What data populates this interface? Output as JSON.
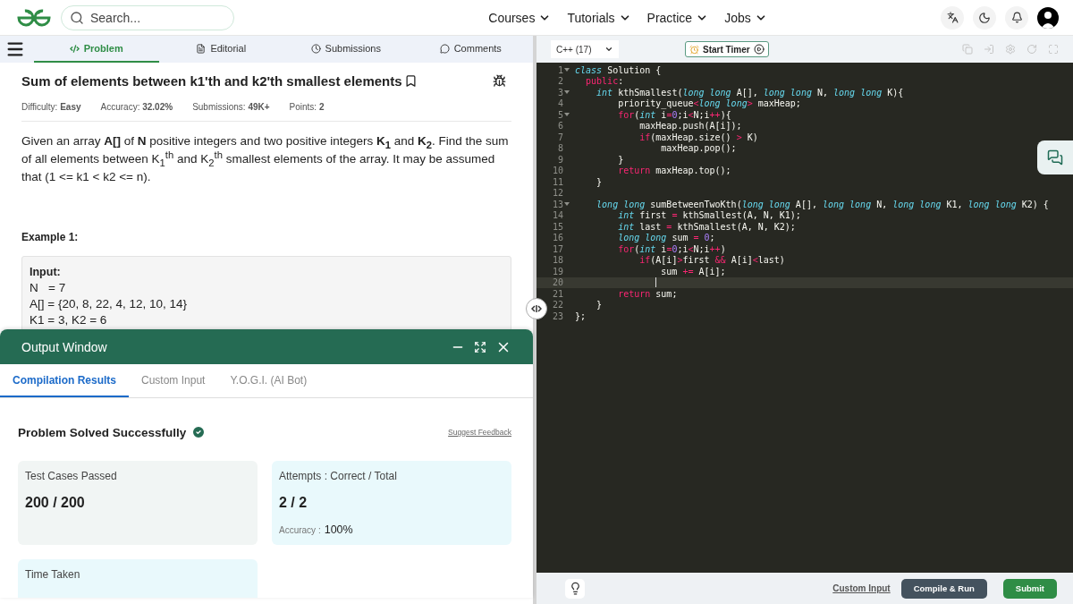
{
  "header": {
    "search": {
      "placeholder": "Search..."
    },
    "nav": [
      {
        "label": "Courses"
      },
      {
        "label": "Tutorials"
      },
      {
        "label": "Practice"
      },
      {
        "label": "Jobs"
      }
    ]
  },
  "problem_tabs": [
    {
      "label": "Problem",
      "selected": true
    },
    {
      "label": "Editorial",
      "selected": false
    },
    {
      "label": "Submissions",
      "selected": false
    },
    {
      "label": "Comments",
      "selected": false
    }
  ],
  "problem": {
    "title": "Sum of elements between k1'th and k2'th smallest elements",
    "meta": [
      "Difficulty: **Easy**",
      "Accuracy: **32.02%**",
      "Submissions: **49K+**",
      "Points: **2**"
    ],
    "description": "Given an array **A[]** of **N** positive integers and two positive integers **K$_{1}$** and **K$_{2}$**. Find the sum of all elements between K$_{1}$$^{th}$ and K$_{2}$$^{th}$ smallest elements of the array. It may be assumed that (1 <= k1 < k2 <= n).",
    "example": {
      "heading": "Example 1:",
      "label": "Input:",
      "lines": [
        "N   = 7",
        "A[] = {20, 8, 22, 4, 12, 10, 14}",
        "K1 = 3, K2 = 6"
      ]
    }
  },
  "output_window": {
    "title": "Output Window",
    "tabs": [
      {
        "label": "Compilation Results",
        "selected": true
      },
      {
        "label": "Custom Input",
        "selected": false
      },
      {
        "label": "Y.O.G.I. (AI Bot)",
        "selected": false
      }
    ],
    "status": "Problem Solved Successfully",
    "feedback_link": "Suggest Feedback",
    "cards": [
      {
        "title": "Test Cases Passed",
        "value": "200 / 200",
        "color": "#f1f5f4"
      },
      {
        "title": "Attempts : Correct / Total",
        "value": "2 / 2",
        "note_label": "Accuracy :",
        "note_value": "100%",
        "color": "#e9f9fc"
      },
      {
        "title": "Time Taken",
        "color": "#e9f9fc"
      }
    ]
  },
  "editor": {
    "language": "C++ (17)",
    "timer_button": "Start Timer",
    "lines": [
      {
        "number": "1",
        "fold": true,
        "current": false,
        "tokens": [
          {
            "kind": "storage",
            "text": "class"
          },
          {
            "kind": "plain",
            "text": " Solution {"
          }
        ]
      },
      {
        "number": "2",
        "fold": false,
        "current": false,
        "tokens": [
          {
            "kind": "keyword",
            "text": "  public"
          },
          {
            "kind": "plain",
            "text": ":"
          }
        ]
      },
      {
        "number": "3",
        "fold": true,
        "current": false,
        "tokens": [
          {
            "kind": "storage",
            "text": "    int"
          },
          {
            "kind": "plain",
            "text": " kthSmallest("
          },
          {
            "kind": "storage",
            "text": "long long"
          },
          {
            "kind": "plain",
            "text": " A[], "
          },
          {
            "kind": "storage",
            "text": "long long"
          },
          {
            "kind": "plain",
            "text": " N, "
          },
          {
            "kind": "storage",
            "text": "long long"
          },
          {
            "kind": "plain",
            "text": " K){"
          }
        ]
      },
      {
        "number": "4",
        "fold": false,
        "current": false,
        "tokens": [
          {
            "kind": "plain",
            "text": "        priority_queue"
          },
          {
            "kind": "operator",
            "text": "<"
          },
          {
            "kind": "storage",
            "text": "long long"
          },
          {
            "kind": "operator",
            "text": ">"
          },
          {
            "kind": "plain",
            "text": " maxHeap;"
          }
        ]
      },
      {
        "number": "5",
        "fold": true,
        "current": false,
        "tokens": [
          {
            "kind": "keyword",
            "text": "        for"
          },
          {
            "kind": "plain",
            "text": "("
          },
          {
            "kind": "storage",
            "text": "int"
          },
          {
            "kind": "plain",
            "text": " i"
          },
          {
            "kind": "operator",
            "text": "="
          },
          {
            "kind": "number",
            "text": "0"
          },
          {
            "kind": "plain",
            "text": ";i"
          },
          {
            "kind": "operator",
            "text": "<"
          },
          {
            "kind": "plain",
            "text": "N;i"
          },
          {
            "kind": "operator",
            "text": "++"
          },
          {
            "kind": "plain",
            "text": "){"
          }
        ]
      },
      {
        "number": "6",
        "fold": false,
        "current": false,
        "tokens": [
          {
            "kind": "plain",
            "text": "            maxHeap.push(A[i]);"
          }
        ]
      },
      {
        "number": "7",
        "fold": false,
        "current": false,
        "tokens": [
          {
            "kind": "keyword",
            "text": "            if"
          },
          {
            "kind": "plain",
            "text": "(maxHeap.size() "
          },
          {
            "kind": "operator",
            "text": ">"
          },
          {
            "kind": "plain",
            "text": " K)"
          }
        ]
      },
      {
        "number": "8",
        "fold": false,
        "current": false,
        "tokens": [
          {
            "kind": "plain",
            "text": "                maxHeap.pop();"
          }
        ]
      },
      {
        "number": "9",
        "fold": false,
        "current": false,
        "tokens": [
          {
            "kind": "plain",
            "text": "        }"
          }
        ]
      },
      {
        "number": "10",
        "fold": false,
        "current": false,
        "tokens": [
          {
            "kind": "keyword",
            "text": "        return"
          },
          {
            "kind": "plain",
            "text": " maxHeap.top();"
          }
        ]
      },
      {
        "number": "11",
        "fold": false,
        "current": false,
        "tokens": [
          {
            "kind": "plain",
            "text": "    }"
          }
        ]
      },
      {
        "number": "12",
        "fold": false,
        "current": false
      },
      {
        "number": "13",
        "fold": true,
        "current": false,
        "tokens": [
          {
            "kind": "storage",
            "text": "    long long"
          },
          {
            "kind": "plain",
            "text": " sumBetweenTwoKth("
          },
          {
            "kind": "storage",
            "text": "long long"
          },
          {
            "kind": "plain",
            "text": " A[], "
          },
          {
            "kind": "storage",
            "text": "long long"
          },
          {
            "kind": "plain",
            "text": " N, "
          },
          {
            "kind": "storage",
            "text": "long long"
          },
          {
            "kind": "plain",
            "text": " K1, "
          },
          {
            "kind": "storage",
            "text": "long long"
          },
          {
            "kind": "plain",
            "text": " K2) {"
          }
        ]
      },
      {
        "number": "14",
        "fold": false,
        "current": false,
        "tokens": [
          {
            "kind": "storage",
            "text": "        int"
          },
          {
            "kind": "plain",
            "text": " first "
          },
          {
            "kind": "operator",
            "text": "="
          },
          {
            "kind": "plain",
            "text": " kthSmallest(A, N, K1);"
          }
        ]
      },
      {
        "number": "15",
        "fold": false,
        "current": false,
        "tokens": [
          {
            "kind": "storage",
            "text": "        int"
          },
          {
            "kind": "plain",
            "text": " last "
          },
          {
            "kind": "operator",
            "text": "="
          },
          {
            "kind": "plain",
            "text": " kthSmallest(A, N, K2);"
          }
        ]
      },
      {
        "number": "16",
        "fold": false,
        "current": false,
        "tokens": [
          {
            "kind": "storage",
            "text": "        long long"
          },
          {
            "kind": "plain",
            "text": " sum "
          },
          {
            "kind": "operator",
            "text": "="
          },
          {
            "kind": "number",
            "text": " 0"
          },
          {
            "kind": "plain",
            "text": ";"
          }
        ]
      },
      {
        "number": "17",
        "fold": false,
        "current": false,
        "tokens": [
          {
            "kind": "keyword",
            "text": "        for"
          },
          {
            "kind": "plain",
            "text": "("
          },
          {
            "kind": "storage",
            "text": "int"
          },
          {
            "kind": "plain",
            "text": " i"
          },
          {
            "kind": "operator",
            "text": "="
          },
          {
            "kind": "number",
            "text": "0"
          },
          {
            "kind": "plain",
            "text": ";i"
          },
          {
            "kind": "operator",
            "text": "<"
          },
          {
            "kind": "plain",
            "text": "N;i"
          },
          {
            "kind": "operator",
            "text": "++"
          },
          {
            "kind": "plain",
            "text": ")"
          }
        ]
      },
      {
        "number": "18",
        "fold": false,
        "current": false,
        "tokens": [
          {
            "kind": "keyword",
            "text": "            if"
          },
          {
            "kind": "plain",
            "text": "(A[i]"
          },
          {
            "kind": "operator",
            "text": ">"
          },
          {
            "kind": "plain",
            "text": "first "
          },
          {
            "kind": "operator",
            "text": "&&"
          },
          {
            "kind": "plain",
            "text": " A[i]"
          },
          {
            "kind": "operator",
            "text": "<"
          },
          {
            "kind": "plain",
            "text": "last)"
          }
        ]
      },
      {
        "number": "19",
        "fold": false,
        "current": false,
        "tokens": [
          {
            "kind": "plain",
            "text": "                sum "
          },
          {
            "kind": "operator",
            "text": "+="
          },
          {
            "kind": "plain",
            "text": " A[i];"
          }
        ]
      },
      {
        "number": "20",
        "fold": false,
        "current": true
      },
      {
        "number": "21",
        "fold": false,
        "current": false,
        "tokens": [
          {
            "kind": "keyword",
            "text": "        return"
          },
          {
            "kind": "plain",
            "text": " sum;"
          }
        ]
      },
      {
        "number": "22",
        "fold": false,
        "current": false,
        "tokens": [
          {
            "kind": "plain",
            "text": "    }"
          }
        ]
      },
      {
        "number": "23",
        "fold": false,
        "current": false,
        "tokens": [
          {
            "kind": "plain",
            "text": "};"
          }
        ]
      }
    ]
  },
  "footer": {
    "custom_input_link": "Custom Input",
    "buttons": [
      {
        "label": "Compile & Run",
        "kind": "secondary"
      },
      {
        "label": "Submit",
        "kind": "primary"
      }
    ]
  }
}
